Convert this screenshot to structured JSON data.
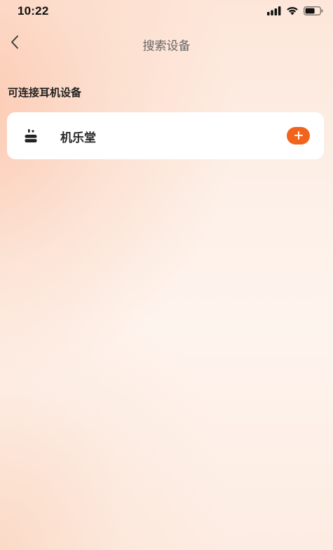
{
  "status_bar": {
    "time": "10:22",
    "icons": [
      "signal-icon",
      "wifi-icon",
      "battery-icon"
    ]
  },
  "nav": {
    "back_icon": "chevron-left-icon",
    "title": "搜索设备"
  },
  "section": {
    "title": "可连接耳机设备"
  },
  "devices": [
    {
      "name": "机乐堂",
      "icon": "earbuds-icon",
      "action_icon": "plus-icon"
    }
  ],
  "colors": {
    "accent": "#f2631b",
    "card": "#ffffff",
    "title_text": "#666666"
  }
}
